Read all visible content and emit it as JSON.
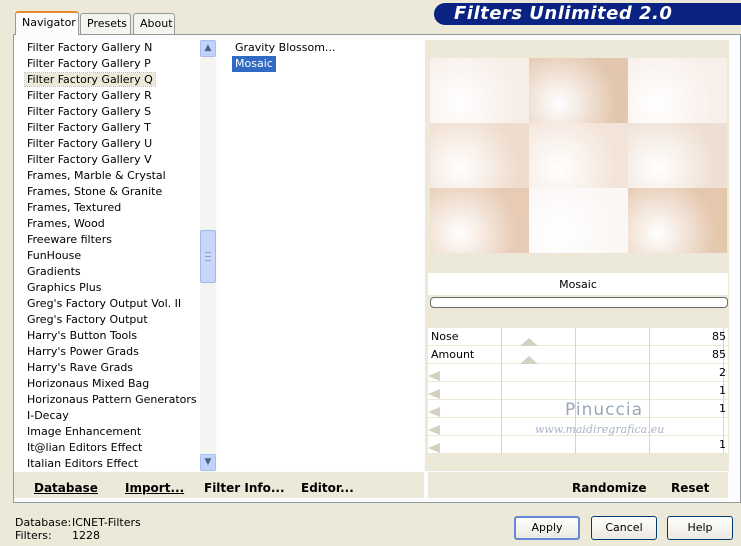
{
  "tabs": [
    "Navigator",
    "Presets",
    "About"
  ],
  "app_title": "Filters Unlimited 2.0",
  "categories": [
    "Filter Factory Gallery N",
    "Filter Factory Gallery P",
    "Filter Factory Gallery Q",
    "Filter Factory Gallery R",
    "Filter Factory Gallery S",
    "Filter Factory Gallery T",
    "Filter Factory Gallery U",
    "Filter Factory Gallery V",
    "Frames, Marble & Crystal",
    "Frames, Stone & Granite",
    "Frames, Textured",
    "Frames, Wood",
    "Freeware filters",
    "FunHouse",
    "Gradients",
    "Graphics Plus",
    "Greg's Factory Output Vol. II",
    "Greg's Factory Output",
    "Harry's Button Tools",
    "Harry's Power Grads",
    "Harry's Rave Grads",
    "Horizonaus Mixed Bag",
    "Horizonaus Pattern Generators",
    "I-Decay",
    "Image Enhancement",
    "It@lian Editors Effect",
    "Italian Editors Effect"
  ],
  "selected_category": "Filter Factory Gallery Q",
  "filters": [
    "Gravity Blossom...",
    "Mosaic"
  ],
  "selected_filter": "Mosaic",
  "filter_name": "Mosaic",
  "progress": 0,
  "params": [
    {
      "label": "Nose",
      "value": "85"
    },
    {
      "label": "Amount",
      "value": "85"
    },
    {
      "label": "",
      "value": "2"
    },
    {
      "label": "",
      "value": "1"
    },
    {
      "label": "",
      "value": "1"
    },
    {
      "label": "",
      "value": ""
    },
    {
      "label": "",
      "value": "1"
    }
  ],
  "watermark": {
    "name": "Pinuccia",
    "url": "www.maidiregrafica.eu"
  },
  "bottom_buttons": {
    "database": "Database",
    "import": "Import...",
    "filter_info": "Filter Info...",
    "editor": "Editor...",
    "randomize": "Randomize",
    "reset": "Reset"
  },
  "status": {
    "database_label": "Database:",
    "database_value": "ICNET-Filters",
    "filters_label": "Filters:",
    "filters_value": "1228"
  },
  "dialog_buttons": {
    "apply": "Apply",
    "cancel": "Cancel",
    "help": "Help"
  },
  "colors": {
    "banner": "#0a2282",
    "selection": "#316ac5"
  }
}
